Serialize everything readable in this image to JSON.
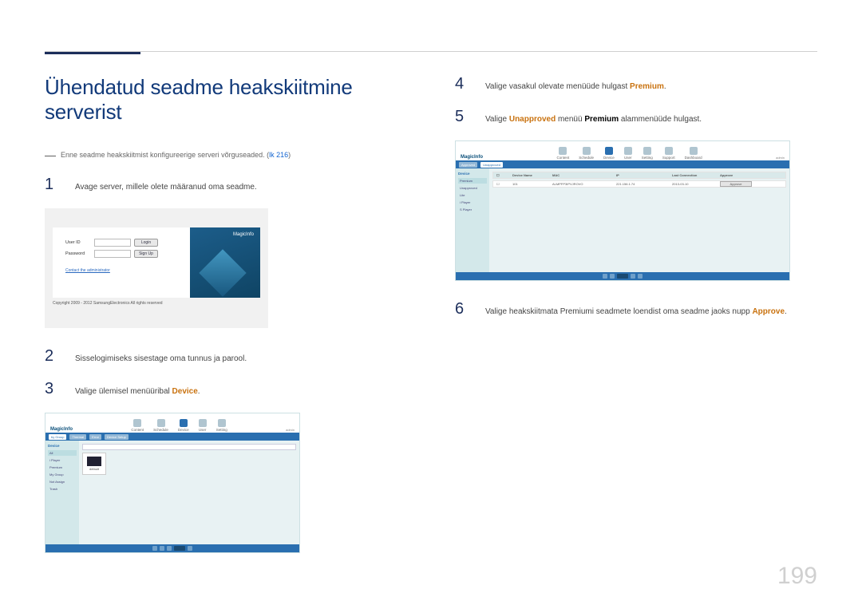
{
  "headline": "Ühendatud seadme heakskiitmine serverist",
  "note_pre": "Enne seadme heakskiitmist konfigureerige serveri võrguseaded. (",
  "note_link": "lk 216",
  "note_post": ")",
  "steps": {
    "s1": "Avage server, millele olete määranud oma seadme.",
    "s2": "Sisselogimiseks sisestage oma tunnus ja parool.",
    "s3_pre": "Valige ülemisel menüüribal ",
    "s3_hl": "Device",
    "s3_post": ".",
    "s4_pre": "Valige vasakul olevate menüüde hulgast ",
    "s4_hl": "Premium",
    "s4_post": ".",
    "s5_pre": "Valige ",
    "s5_hl1": "Unapproved",
    "s5_mid": " menüü ",
    "s5_hl2": "Premium",
    "s5_post": " alammenüüde hulgast.",
    "s6_pre": "Valige heakskiitmata Premiumi seadmete loendist oma seadme jaoks nupp ",
    "s6_hl": "Approve",
    "s6_post": "."
  },
  "login": {
    "userid_label": "User ID",
    "password_label": "Password",
    "login_btn": "Login",
    "signup_btn": "Sign Up",
    "admin_link": "Contact the administrator",
    "brand": "MagicInfo",
    "copyright": "Copyright 2009 - 2012 SamsungElectronics All rights reserved"
  },
  "app": {
    "brand": "MagicInfo",
    "tabs": [
      "Content",
      "Schedule",
      "Device",
      "User",
      "Setting",
      "Support",
      "Dashboard"
    ],
    "subtabs_view": [
      "by Group",
      "Thermal",
      "Error",
      "Device Setup"
    ],
    "sidebar_header": "Device",
    "sidebar_items": [
      "All",
      "i Player",
      "Premium",
      "My Group",
      "Not Assign",
      "Trash"
    ],
    "sidebar_header2": "Device",
    "sidebar_items2": [
      "Premium",
      "Unapproved",
      "Lite",
      "i Player",
      "S Player"
    ],
    "table": {
      "cols": [
        "Device Name",
        "MAC",
        "IP",
        "Last Connection",
        "Approve"
      ],
      "row1": {
        "name": "101",
        "mac": "ALMPFP3IPVJROVO",
        "ip": "221.156.1.74",
        "ts": "2013-03-10",
        "act": "Approve"
      }
    },
    "user": "admin"
  },
  "page_number": "199"
}
